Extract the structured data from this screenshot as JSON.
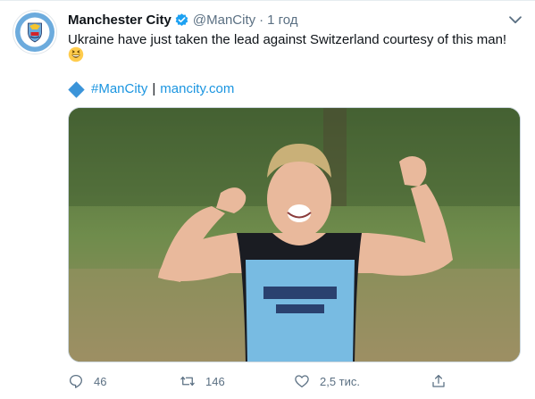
{
  "tweet": {
    "name": "Manchester City",
    "handle": "@ManCity",
    "separator": "·",
    "time": "1 год",
    "text": "Ukraine have just taken the lead against Switzerland courtesy of this man!",
    "hashtag": "#ManCity",
    "divider": "|",
    "site_link": "mancity.com",
    "reply_count": "46",
    "retweet_count": "146",
    "like_count": "2,5 тис."
  },
  "icons": {
    "verified": "verified-badge-icon",
    "more": "chevron-down-icon",
    "emoji": "grinning-face-emoji",
    "diamond": "blue-diamond-emoji",
    "reply": "reply-icon",
    "retweet": "retweet-icon",
    "like": "heart-icon",
    "share": "share-icon"
  },
  "colors": {
    "link": "#1b95e0",
    "verified": "#1da1f2",
    "secondary_text": "#5b7083",
    "club_blue": "#6cabdd"
  }
}
